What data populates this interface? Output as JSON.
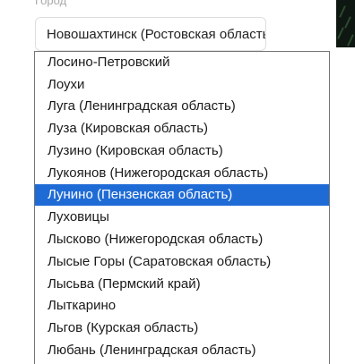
{
  "field": {
    "label": "Город",
    "value": "Новошахтинск (Ростовская область)"
  },
  "dropdown": {
    "options": [
      "Лосино-Петровский",
      "Лоухи",
      "Луга (Ленинградская область)",
      "Луза (Кировская область)",
      "Лузино (Кировская область)",
      "Лукоянов (Нижегородская область)",
      "Лунино (Пензенская область)",
      "Луховицы",
      "Лысково (Нижегородская область)",
      "Лысые Горы (Саратовская область)",
      "Лысьва (Пермский край)",
      "Лыткарино",
      "Льгов (Курская область)",
      "Любань (Ленинградская область)"
    ],
    "highlighted_index": 6
  },
  "colors": {
    "highlight": "#1f6bd6",
    "label_gray": "#a9a9a9"
  }
}
